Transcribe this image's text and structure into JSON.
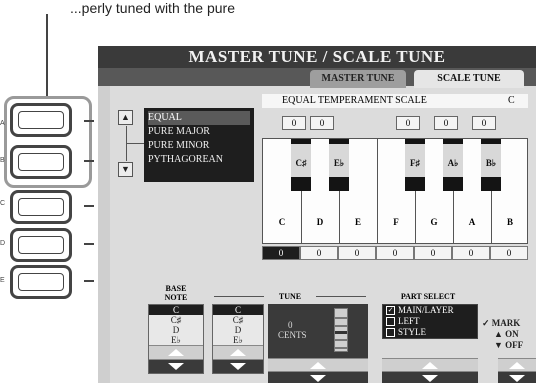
{
  "caption": "...perly tuned with the pure",
  "hw_buttons": [
    {
      "letter": "A"
    },
    {
      "letter": "B"
    },
    {
      "letter": "C"
    },
    {
      "letter": "D"
    },
    {
      "letter": "E"
    }
  ],
  "screen": {
    "title": "MASTER TUNE / SCALE TUNE",
    "tabs": [
      {
        "label": "MASTER TUNE",
        "active": false
      },
      {
        "label": "SCALE TUNE",
        "active": true
      }
    ],
    "scale_list": [
      "EQUAL",
      "PURE MAJOR",
      "PURE MINOR",
      "PYTHAGOREAN"
    ],
    "selected_scale": "EQUAL",
    "scale_name": "EQUAL TEMPERAMENT SCALE",
    "base_key": "C",
    "black_tune": [
      "0",
      "0",
      "0",
      "0",
      "0"
    ],
    "black_keys": [
      "C♯",
      "E♭",
      "F♯",
      "A♭",
      "B♭"
    ],
    "white_keys": [
      "C",
      "D",
      "E",
      "F",
      "G",
      "A",
      "B"
    ],
    "white_tune": [
      "0",
      "0",
      "0",
      "0",
      "0",
      "0",
      "0"
    ],
    "base_note": {
      "header_line1": "BASE",
      "header_line2": "NOTE",
      "items": [
        "C",
        "C♯",
        "D",
        "E♭"
      ]
    },
    "tune_column": {
      "items": [
        "C",
        "C♯",
        "D",
        "E♭"
      ]
    },
    "tune": {
      "header": "TUNE",
      "value": "0",
      "unit": "CENTS"
    },
    "part_select": {
      "header": "PART SELECT",
      "items": [
        {
          "label": "MAIN/LAYER",
          "checked": true
        },
        {
          "label": "LEFT",
          "checked": false
        },
        {
          "label": "STYLE",
          "checked": false
        }
      ]
    },
    "mark": {
      "label": "MARK",
      "on": "▲ ON",
      "off": "▼ OFF"
    }
  }
}
